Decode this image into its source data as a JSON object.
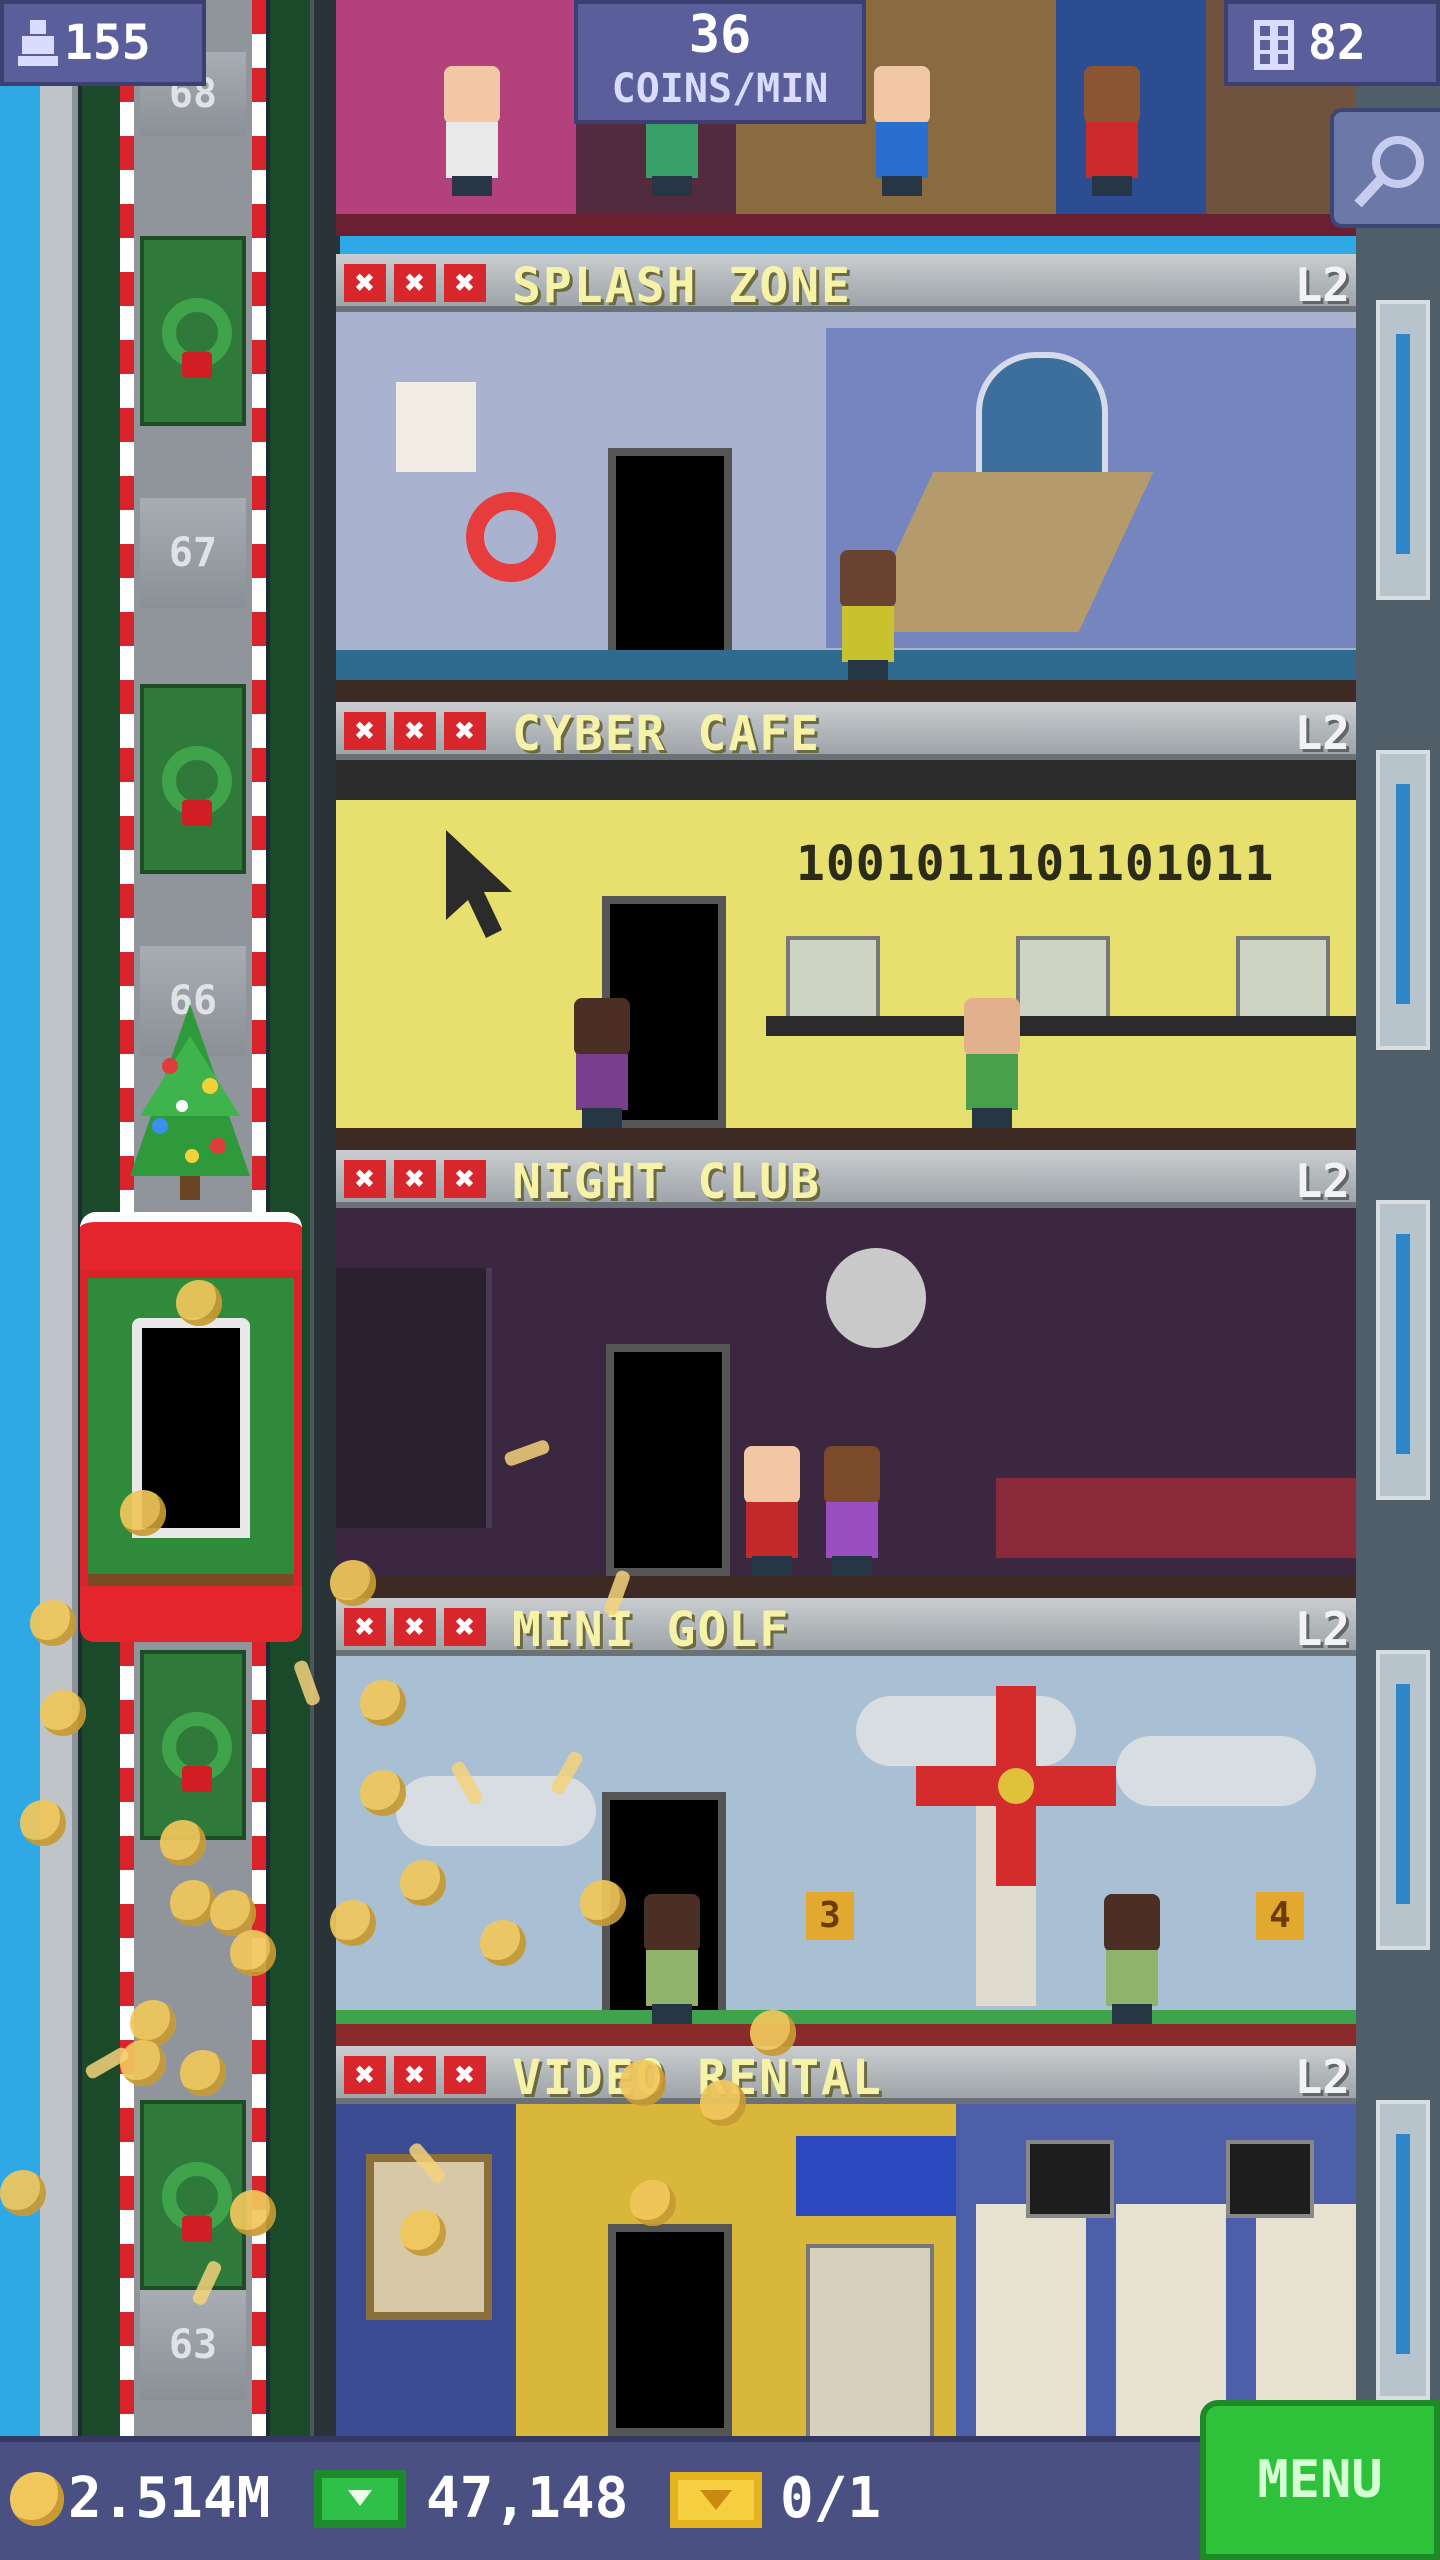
{
  "hud": {
    "population": "155",
    "coins_per_min_value": "36",
    "coins_per_min_unit": "COINS/MIN",
    "floors_count": "82"
  },
  "elevator_floor_numbers": [
    "68",
    "67",
    "66",
    "63"
  ],
  "floors": [
    {
      "name": "SPLASH ZONE",
      "level": "L2",
      "x_marks": [
        "✖",
        "✖",
        "✖"
      ]
    },
    {
      "name": "CYBER CAFE",
      "level": "L2",
      "x_marks": [
        "✖",
        "✖",
        "✖"
      ],
      "wall_text": "1001011101101011"
    },
    {
      "name": "NIGHT CLUB",
      "level": "L2",
      "x_marks": [
        "✖",
        "✖",
        "✖"
      ]
    },
    {
      "name": "MINI GOLF",
      "level": "L2",
      "x_marks": [
        "✖",
        "✖",
        "✖"
      ],
      "hole_numbers": [
        "3",
        "4"
      ]
    },
    {
      "name": "VIDEO RENTAL",
      "level": "L2",
      "x_marks": [
        "✖",
        "✖",
        "✖"
      ]
    }
  ],
  "bottom_bar": {
    "coins": "2.514M",
    "bux": "47,148",
    "tickets": "0/1",
    "menu_label": "MENU"
  },
  "colors": {
    "sky": "#2fa9e6",
    "hud_panel": "#5a5f9b",
    "banner_text": "#f6f2a8",
    "x_mark": "#d7262c",
    "menu_green": "#2ec23a"
  },
  "icons": {
    "population": "person-icon",
    "floors": "building-icon",
    "search": "magnifier-icon",
    "coin": "coin-icon",
    "bux": "banknote-icon",
    "ticket": "ticket-icon"
  }
}
